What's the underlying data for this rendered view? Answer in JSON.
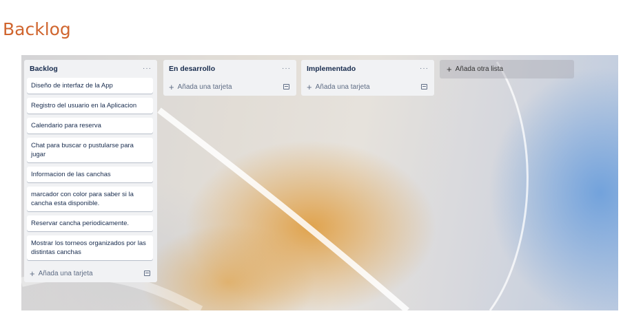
{
  "page": {
    "heading": "Backlog"
  },
  "board": {
    "lists": [
      {
        "title": "Backlog",
        "menu": "···",
        "cards": [
          "Diseño de interfaz de la App",
          "Registro del usuario en la Aplicacion",
          "Calendario para reserva",
          "Chat para buscar o pustularse para jugar",
          "Informacion de las canchas",
          "marcador con color para saber si la cancha esta disponible.",
          "Reservar cancha periodicamente.",
          "Mostrar los torneos organizados por las distintas canchas"
        ],
        "add_card": "Añada una tarjeta"
      },
      {
        "title": "En desarrollo",
        "menu": "···",
        "cards": [],
        "add_card": "Añada una tarjeta"
      },
      {
        "title": "Implementado",
        "menu": "···",
        "cards": [],
        "add_card": "Añada una tarjeta"
      }
    ],
    "add_list": "Añada otra lista"
  },
  "icons": {
    "plus": "plus-icon",
    "menu": "more-dots-icon",
    "template": "card-template-icon"
  },
  "colors": {
    "heading": "#d0652e",
    "list_bg": "#f1f2f4",
    "text": "#172b4d"
  }
}
